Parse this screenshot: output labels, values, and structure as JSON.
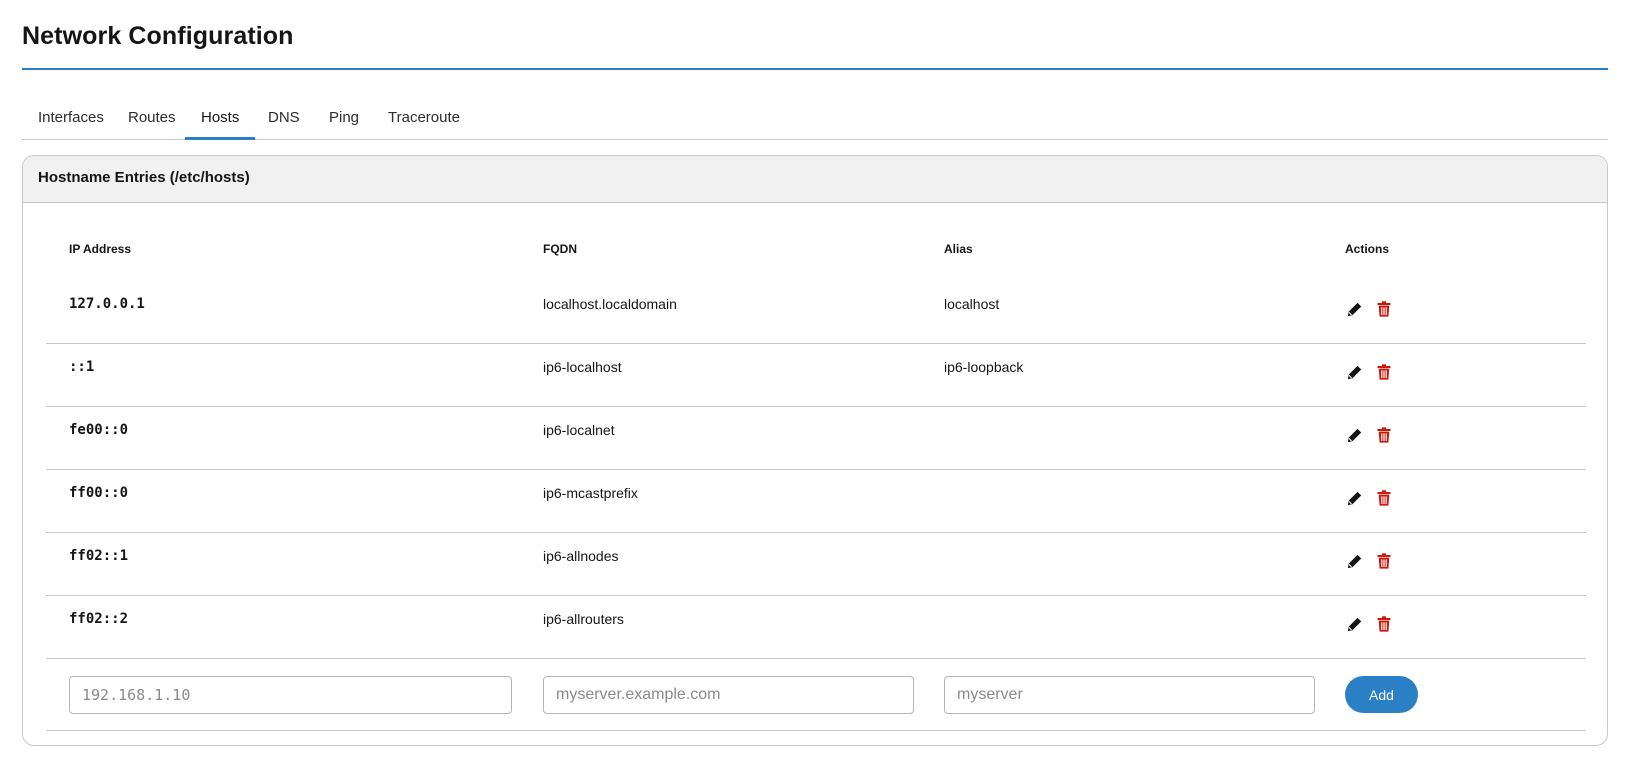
{
  "page": {
    "title": "Network Configuration"
  },
  "tabs": [
    {
      "label": "Interfaces",
      "active": false
    },
    {
      "label": "Routes",
      "active": false
    },
    {
      "label": "Hosts",
      "active": true
    },
    {
      "label": "DNS",
      "active": false
    },
    {
      "label": "Ping",
      "active": false
    },
    {
      "label": "Traceroute",
      "active": false
    }
  ],
  "hosts": {
    "title": "Hostname Entries (/etc/hosts)",
    "columns": {
      "ip": "IP Address",
      "fqdn": "FQDN",
      "alias": "Alias",
      "actions": "Actions"
    },
    "rows": [
      {
        "ip": "127.0.0.1",
        "fqdn": "localhost.localdomain",
        "alias": "localhost"
      },
      {
        "ip": "::1",
        "fqdn": "ip6-localhost",
        "alias": "ip6-loopback"
      },
      {
        "ip": "fe00::0",
        "fqdn": "ip6-localnet",
        "alias": ""
      },
      {
        "ip": "ff00::0",
        "fqdn": "ip6-mcastprefix",
        "alias": ""
      },
      {
        "ip": "ff02::1",
        "fqdn": "ip6-allnodes",
        "alias": ""
      },
      {
        "ip": "ff02::2",
        "fqdn": "ip6-allrouters",
        "alias": ""
      }
    ],
    "new_entry": {
      "ip_placeholder": "192.168.1.10",
      "fqdn_placeholder": "myserver.example.com",
      "alias_placeholder": "myserver",
      "ip_value": "",
      "fqdn_value": "",
      "alias_value": "",
      "add_label": "Add"
    }
  },
  "icons": {
    "edit": "pencil-icon",
    "delete": "trash-icon"
  },
  "colors": {
    "accent": "#2b7fc4",
    "delete": "#c9190b",
    "edit": "#151515"
  }
}
